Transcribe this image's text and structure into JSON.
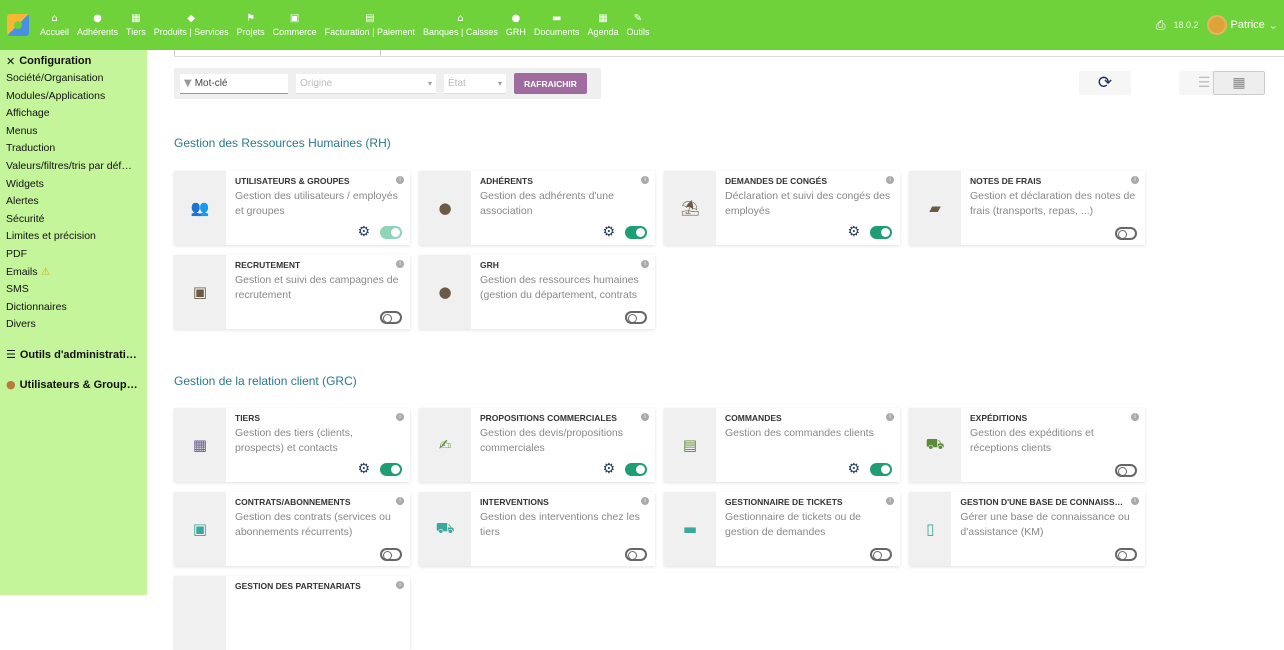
{
  "topnav": {
    "items": [
      {
        "label": "Accueil",
        "icon": "home-icon",
        "glyph": "⌂"
      },
      {
        "label": "Adhérents",
        "icon": "member-icon",
        "glyph": "●"
      },
      {
        "label": "Tiers",
        "icon": "building-icon",
        "glyph": "▦"
      },
      {
        "label": "Produits | Services",
        "icon": "cube-icon",
        "glyph": "◆"
      },
      {
        "label": "Projets",
        "icon": "project-icon",
        "glyph": "⚑"
      },
      {
        "label": "Commerce",
        "icon": "briefcase-icon",
        "glyph": "▣"
      },
      {
        "label": "Facturation | Paiement",
        "icon": "invoice-icon",
        "glyph": "▤"
      },
      {
        "label": "Banques | Caisses",
        "icon": "bank-icon",
        "glyph": "⌂"
      },
      {
        "label": "GRH",
        "icon": "hr-icon",
        "glyph": "●"
      },
      {
        "label": "Documents",
        "icon": "folder-icon",
        "glyph": "▬"
      },
      {
        "label": "Agenda",
        "icon": "calendar-icon",
        "glyph": "▦"
      },
      {
        "label": "Outils",
        "icon": "wrench-icon",
        "glyph": "✎"
      }
    ],
    "version": "18.0.2",
    "user_name": "Patrice"
  },
  "sidebar": {
    "heading": "Configuration",
    "items": [
      "Société/Organisation",
      "Modules/Applications",
      "Affichage",
      "Menus",
      "Traduction",
      "Valeurs/filtres/tris par déf…",
      "Widgets",
      "Alertes",
      "Sécurité",
      "Limites et précision",
      "PDF",
      "Emails",
      "SMS",
      "Dictionnaires",
      "Divers"
    ],
    "admin_tools": "Outils d'administrati…",
    "users_groups": "Utilisateurs & Group…"
  },
  "filters": {
    "keyword_placeholder": "Mot-clé",
    "origin_placeholder": "Origine",
    "state_placeholder": "État",
    "refresh_label": "RAFRAICHIR"
  },
  "sections": [
    {
      "title": "Gestion des Ressources Humaines (RH)",
      "cards": [
        {
          "title": "UTILISATEURS & GROUPES",
          "desc": "Gestion des utilisateurs / employés et groupes",
          "icon": "users-icon",
          "glyph": "👥",
          "color": "#4b5e7a",
          "gear": true,
          "toggle": "onlight"
        },
        {
          "title": "ADHÉRENTS",
          "desc": "Gestion des adhérents d'une association",
          "icon": "member-icon",
          "glyph": "●",
          "color": "#6b5a45",
          "gear": true,
          "toggle": "on"
        },
        {
          "title": "DEMANDES DE CONGÉS",
          "desc": "Déclaration et suivi des congés des employés",
          "icon": "beach-icon",
          "glyph": "⛱",
          "color": "#6b5a45",
          "gear": true,
          "toggle": "on"
        },
        {
          "title": "NOTES DE FRAIS",
          "desc": "Gestion et déclaration des notes de frais (transports, repas, ...)",
          "icon": "wallet-icon",
          "glyph": "▰",
          "color": "#6b5a45",
          "gear": false,
          "toggle": "off"
        },
        {
          "title": "RECRUTEMENT",
          "desc": "Gestion et suivi des campagnes de recrutement",
          "icon": "id-badge-icon",
          "glyph": "▣",
          "color": "#6b5a45",
          "gear": false,
          "toggle": "off"
        },
        {
          "title": "GRH",
          "desc": "Gestion des ressources humaines (gestion du département, contrats d…",
          "icon": "user-tie-icon",
          "glyph": "●",
          "color": "#6b5a45",
          "gear": false,
          "toggle": "off"
        }
      ]
    },
    {
      "title": "Gestion de la relation client (GRC)",
      "cards": [
        {
          "title": "TIERS",
          "desc": "Gestion des tiers (clients, prospects) et contacts",
          "icon": "building-icon",
          "glyph": "▦",
          "color": "#6a5a8a",
          "gear": true,
          "toggle": "on"
        },
        {
          "title": "PROPOSITIONS COMMERCIALES",
          "desc": "Gestion des devis/propositions commerciales",
          "icon": "file-signature-icon",
          "glyph": "✍",
          "color": "#5a8a3a",
          "gear": true,
          "toggle": "on"
        },
        {
          "title": "COMMANDES",
          "desc": "Gestion des commandes clients",
          "icon": "file-invoice-icon",
          "glyph": "▤",
          "color": "#5a8a3a",
          "gear": true,
          "toggle": "on"
        },
        {
          "title": "EXPÉDITIONS",
          "desc": "Gestion des expéditions et réceptions clients",
          "icon": "dolly-icon",
          "glyph": "⛟",
          "color": "#5a8a3a",
          "gear": false,
          "toggle": "off"
        },
        {
          "title": "CONTRATS/ABONNEMENTS",
          "desc": "Gestion des contrats (services ou abonnements récurrents)",
          "icon": "suitcase-icon",
          "glyph": "▣",
          "color": "#3aa89a",
          "gear": false,
          "toggle": "off"
        },
        {
          "title": "INTERVENTIONS",
          "desc": "Gestion des interventions chez les tiers",
          "icon": "ambulance-icon",
          "glyph": "⛟",
          "color": "#3aa89a",
          "gear": false,
          "toggle": "off"
        },
        {
          "title": "GESTIONNAIRE DE TICKETS",
          "desc": "Gestionnaire de tickets ou de gestion de demandes internes/clients…",
          "icon": "ticket-icon",
          "glyph": "▬",
          "color": "#3aa89a",
          "gear": false,
          "toggle": "off"
        },
        {
          "title": "GESTION D'UNE BASE DE CONNAISS…",
          "desc": "Gérer une base de connaissance ou d'assistance (KM)",
          "icon": "book-icon",
          "glyph": "▯",
          "color": "#3aa89a",
          "gear": false,
          "toggle": "off"
        },
        {
          "title": "GESTION DES PARTENARIATS",
          "desc": "",
          "icon": "handshake-icon",
          "glyph": "",
          "color": "#3aa89a",
          "gear": false,
          "toggle": "none"
        }
      ]
    }
  ],
  "colors": {
    "topbar": "#6fd23a",
    "sidebar": "#c4f59a",
    "accent_button": "#a06c9f",
    "section_title": "#2b7a8c",
    "toggle_on": "#1f9e73"
  }
}
